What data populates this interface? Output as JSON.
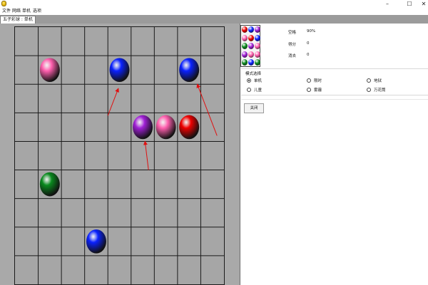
{
  "window": {
    "title": "",
    "controls": {
      "minimize": "–",
      "maximize": "☐",
      "close": "✕"
    }
  },
  "menu": [
    "文件",
    "网络",
    "单机",
    "选项"
  ],
  "tab": {
    "label": "五子彩球 : 单机"
  },
  "board": {
    "rows": 9,
    "cols": 9,
    "balls": [
      {
        "row": 1,
        "col": 1,
        "color": "pink"
      },
      {
        "row": 1,
        "col": 4,
        "color": "blue"
      },
      {
        "row": 1,
        "col": 7,
        "color": "blue"
      },
      {
        "row": 3,
        "col": 5,
        "color": "purple"
      },
      {
        "row": 3,
        "col": 6,
        "color": "pink"
      },
      {
        "row": 3,
        "col": 7,
        "color": "red"
      },
      {
        "row": 5,
        "col": 1,
        "color": "green"
      },
      {
        "row": 7,
        "col": 3,
        "color": "blue"
      }
    ],
    "arrows": [
      {
        "from": [
          4.0,
          3.1
        ],
        "to": [
          4.45,
          2.15
        ]
      },
      {
        "from": [
          5.75,
          5.0
        ],
        "to": [
          5.6,
          4.0
        ]
      },
      {
        "from": [
          8.7,
          3.8
        ],
        "to": [
          7.85,
          2.0
        ]
      }
    ],
    "arrow_color": "#e01010",
    "ball_colors": {
      "pink": "#ff5fae",
      "blue": "#0a21ff",
      "purple": "#a01fd6",
      "red": "#ee0000",
      "green": "#0a8a1e"
    }
  },
  "side_panel": {
    "preview_balls": [
      "red",
      "blue",
      "purple",
      "pink",
      "red",
      "blue",
      "green",
      "purple",
      "pink",
      "purple",
      "pink",
      "pink",
      "green",
      "blue",
      "green"
    ],
    "stats": {
      "capacity_label": "空格",
      "capacity_value": "90%",
      "score_label": "得分",
      "score_value": "0",
      "eliminated_label": "消去",
      "eliminated_value": "0"
    },
    "mode": {
      "title": "模式选择",
      "options": [
        "单机",
        "限时",
        "地狱",
        "儿童",
        "雾霾",
        "万花筒"
      ],
      "selected": "单机"
    },
    "close_label": "关闭"
  }
}
